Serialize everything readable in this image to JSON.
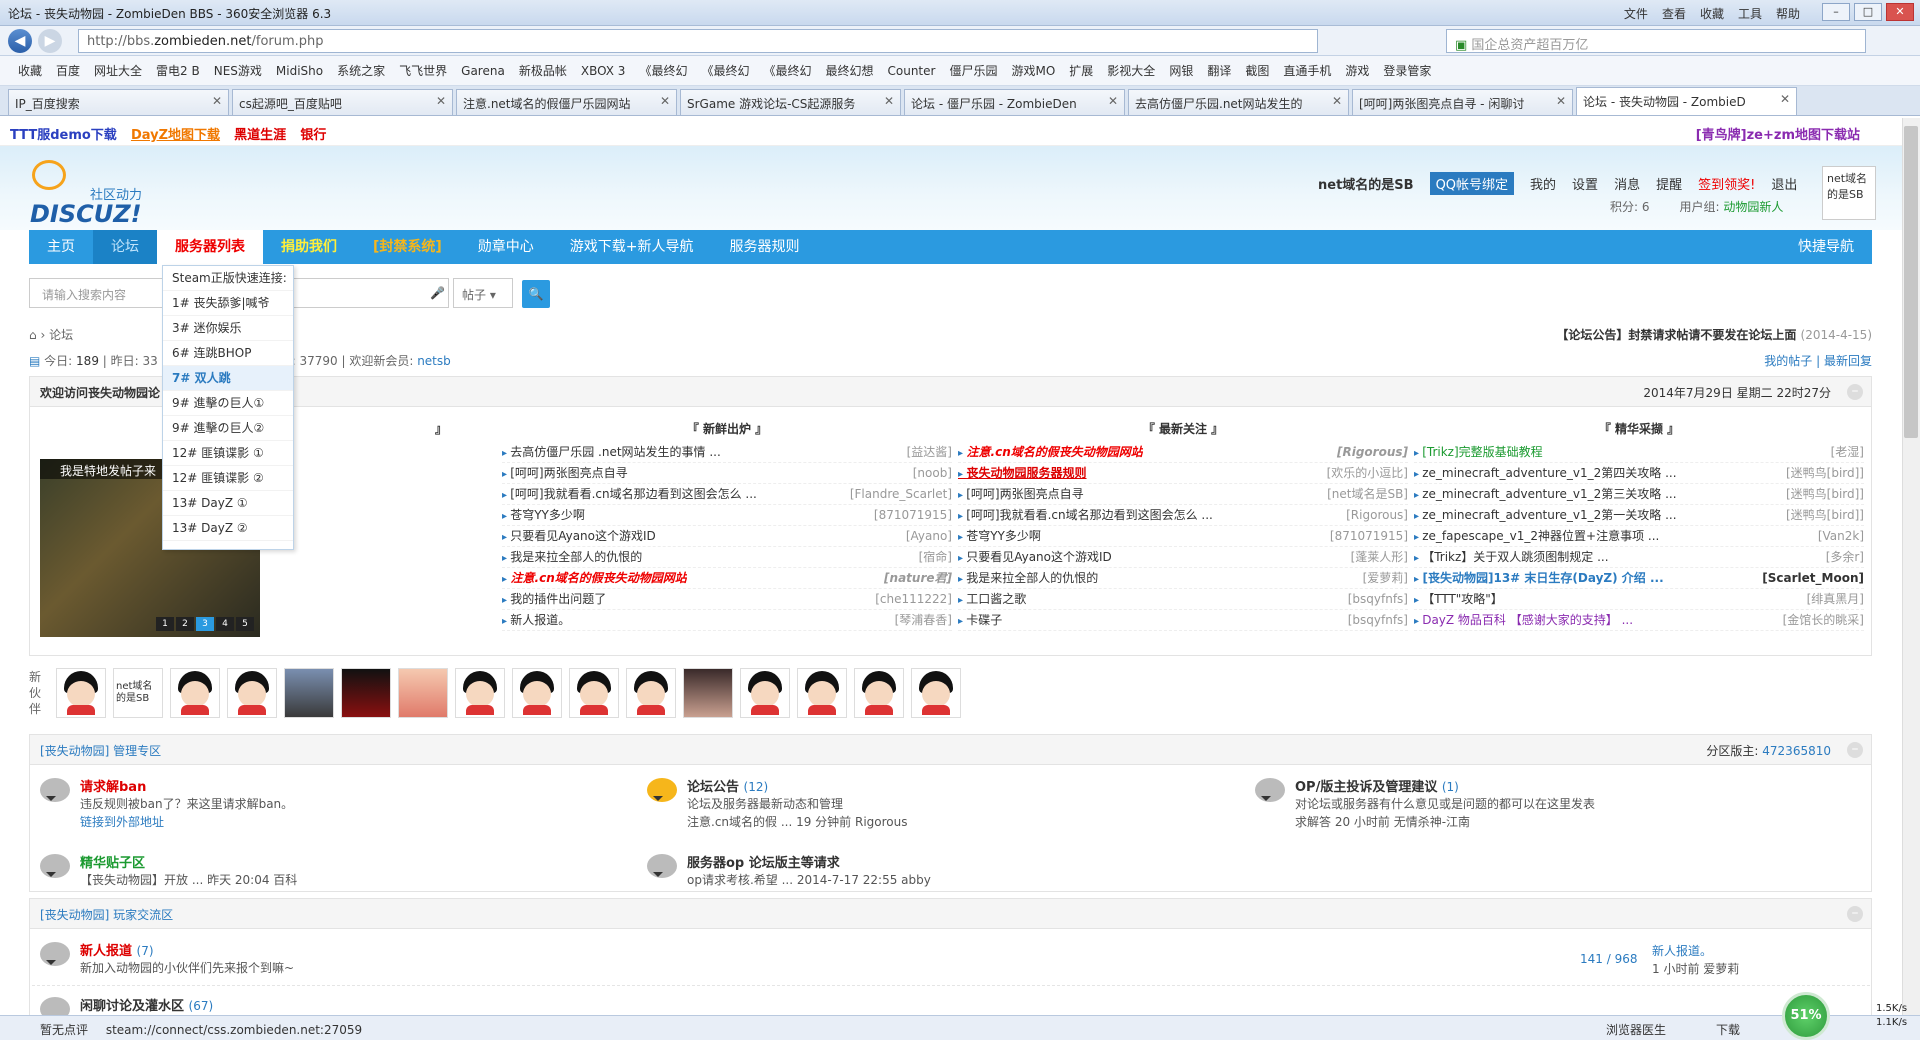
{
  "browser": {
    "title": "论坛 - 丧失动物园 - ZombieDen BBS - 360安全浏览器 6.3",
    "menu": [
      "文件",
      "查看",
      "收藏",
      "工具",
      "帮助"
    ],
    "url_prefix": "http://bbs.",
    "url_domain": "zombieden.net",
    "url_path": "/forum.php",
    "search_placeholder": "国企总资产超百万亿",
    "bookmarks": [
      "收藏",
      "百度",
      "网址大全",
      "雷电2 B",
      "NES游戏",
      "MidiSho",
      "系统之家",
      "飞飞世界",
      "Garena",
      "新极品帐",
      "XBOX 3",
      "《最终幻",
      "《最终幻",
      "《最终幻",
      "最终幻想",
      "Counter",
      "僵尸乐园",
      "游戏MO",
      "扩展",
      "影视大全",
      "网银",
      "翻译",
      "截图",
      "直通手机",
      "游戏",
      "登录管家"
    ],
    "tabs": [
      "IP_百度搜索",
      "cs起源吧_百度贴吧",
      "注意.net域名的假僵尸乐园网站",
      "SrGame 游戏论坛-CS起源服务",
      "论坛 - 僵尸乐园 - ZombieDen",
      "去高仿僵尸乐园.net网站发生的",
      "[呵呵]两张图亮点自寻 - 闲聊讨",
      "论坛 - 丧失动物园 - ZombieD"
    ]
  },
  "notice": {
    "links": [
      "TTT服demo下载",
      "DayZ地图下载",
      "黑道生涯",
      "银行"
    ],
    "right": "[青鸟牌]ze+zm地图下载站"
  },
  "header": {
    "logo_sub": "社区动力",
    "logo": "DISCUZ!",
    "username": "net域名的是SB",
    "qq": "QQ帐号绑定",
    "links": [
      "我的",
      "设置",
      "消息",
      "提醒",
      "签到领奖!",
      "退出"
    ],
    "points": "积分: 6",
    "group_label": "用户组:",
    "group": "动物园新人",
    "avatar_text": "net域名的是SB"
  },
  "nav": [
    "主页",
    "论坛",
    "服务器列表",
    "捐助我们",
    "[封禁系统]",
    "勋章中心",
    "游戏下载+新人导航",
    "服务器规则"
  ],
  "nav_quick": "快捷导航",
  "search": {
    "placeholder": "请输入搜索内容",
    "type": "帖子"
  },
  "dropdown": [
    "Steam正版快速连接:",
    "1# 丧失舔爹|喊爷",
    "3# 迷你娱乐",
    "6# 连跳BHOP",
    "7# 双人跳",
    "9# 進擊の巨人①",
    "9# 進擊の巨人②",
    "12# 匪镇谍影 ①",
    "12# 匪镇谍影 ②",
    "13# DayZ ①",
    "13# DayZ ②"
  ],
  "breadcrumb": "论坛",
  "announce": {
    "text": "【论坛公告】封禁请求帖请不要发在论坛上面",
    "date": "(2014-4-15)"
  },
  "stats": {
    "today_label": "今日:",
    "today": "189",
    "yesterday_label": "昨日: 33",
    "members_label": "员: 37790",
    "newest_label": "欢迎新会员:",
    "newest": "netsb"
  },
  "mylinks": [
    "我的帖子",
    "最新回复"
  ],
  "welcome": {
    "title": "欢迎访问丧失动物园论",
    "date": "2014年7月29日 星期二 22时27分"
  },
  "slide": {
    "caption": "我是特地发帖子来",
    "pages": [
      "1",
      "2",
      "3",
      "4",
      "5"
    ]
  },
  "cols": [
    {
      "title": "『 新鲜出炉 』",
      "items": [
        {
          "t": "去高仿僵尸乐园 .net网站发生的事情 ...",
          "u": "[益达酱]"
        },
        {
          "t": "[呵呵]两张图亮点自寻",
          "u": "[noob]"
        },
        {
          "t": "[呵呵]我就看看.cn域名那边看到这图会怎么 ...",
          "u": "[Flandre_Scarlet]"
        },
        {
          "t": "苍穹YY多少啊",
          "u": "[871071915]"
        },
        {
          "t": "只要看见Ayano这个游戏ID",
          "u": "[Ayano]"
        },
        {
          "t": "我是来拉全部人的仇恨的",
          "u": "[宿命]"
        },
        {
          "t": "注意.cn域名的假丧失动物园网站",
          "u": "[nature君]"
        },
        {
          "t": "我的插件出问题了",
          "u": "[che111222]"
        },
        {
          "t": "新人报道。",
          "u": "[琴浦春香]"
        }
      ]
    },
    {
      "title": "『 最新关注 』",
      "items": [
        {
          "t": "注意.cn域名的假丧失动物园网站",
          "u": "[Rigorous]"
        },
        {
          "t": "丧失动物园服务器规则",
          "u": "[欢乐的小逗比]"
        },
        {
          "t": "[呵呵]两张图亮点自寻",
          "u": "[net域名是SB]"
        },
        {
          "t": "[呵呵]我就看看.cn域名那边看到这图会怎么 ...",
          "u": "[Rigorous]"
        },
        {
          "t": "苍穹YY多少啊",
          "u": "[871071915]"
        },
        {
          "t": "只要看见Ayano这个游戏ID",
          "u": "[蓬莱人形]"
        },
        {
          "t": "我是来拉全部人的仇恨的",
          "u": "[爱萝莉]"
        },
        {
          "t": "工口酱之歌",
          "u": "[bsqyfnfs]"
        },
        {
          "t": "卡碟子",
          "u": "[bsqyfnfs]"
        }
      ]
    },
    {
      "title": "『 精华采撷 』",
      "items": [
        {
          "t": "[Trikz]完整版基础教程",
          "u": "[老湿]"
        },
        {
          "t": "ze_minecraft_adventure_v1_2第四关攻略 ...",
          "u": "[迷鸭鸟[bird]]"
        },
        {
          "t": "ze_minecraft_adventure_v1_2第三关攻略 ...",
          "u": "[迷鸭鸟[bird]]"
        },
        {
          "t": "ze_minecraft_adventure_v1_2第一关攻略 ...",
          "u": "[迷鸭鸟[bird]]"
        },
        {
          "t": "ze_fapescape_v1_2神器位置+注意事项 ...",
          "u": "[Van2k]"
        },
        {
          "t": "【Trikz】关于双人跳须图制规定 ...",
          "u": "[多余r]"
        },
        {
          "t": "[丧失动物园]13# 末日生存(DayZ) 介绍 ...",
          "u": "[Scarlet_Moon]"
        },
        {
          "t": "【TTT\"攻略\"】",
          "u": "[绯真黑月]"
        },
        {
          "t": "DayZ 物品百科 【感谢大家的支持】 ...",
          "u": "[金馆长的眺采]"
        }
      ]
    }
  ],
  "partners_label": "新伙伴",
  "section1": {
    "title": "[丧失动物园] 管理专区",
    "mod_label": "分区版主:",
    "mod": "472365810",
    "forums": [
      {
        "name": "请求解ban",
        "desc": "违反规则被ban了？来这里请求解ban。",
        "extra": "链接到外部地址"
      },
      {
        "name": "论坛公告",
        "cnt": "(12)",
        "desc": "论坛及服务器最新动态和管理",
        "extra": "注意.cn域名的假 ... 19 分钟前 Rigorous"
      },
      {
        "name": "OP/版主投诉及管理建议",
        "cnt": "(1)",
        "desc": "对论坛或服务器有什么意见或是问题的都可以在这里发表",
        "extra": "求解答 20 小时前 无情杀神-江南"
      },
      {
        "name": "精华贴子区",
        "desc": "",
        "extra": "【丧失动物园】开放 ... 昨天 20:04 百科"
      },
      {
        "name": "服务器op 论坛版主等请求",
        "desc": "",
        "extra": "op请求考核.希望 ... 2014-7-17 22:55 abby"
      }
    ]
  },
  "section2": {
    "title": "[丧失动物园] 玩家交流区",
    "forums": [
      {
        "name": "新人报道",
        "cnt": "(7)",
        "desc": "新加入动物园的小伙伴们先来报个到嘛~",
        "stats": "141 / 968",
        "last": "新人报道。",
        "lastby": "1 小时前 爱萝莉"
      },
      {
        "name": "闲聊讨论及灌水区",
        "cnt": "(67)",
        "desc": "",
        "stats": "",
        "last": "",
        "lastby": ""
      }
    ]
  },
  "status": {
    "left": "暂无点评",
    "url": "steam://connect/css.zombieden.net:27059",
    "doctor": "浏览器医生",
    "download": "下载",
    "gauge": "51%",
    "up": "1.5K/s",
    "down": "1.1K/s"
  }
}
